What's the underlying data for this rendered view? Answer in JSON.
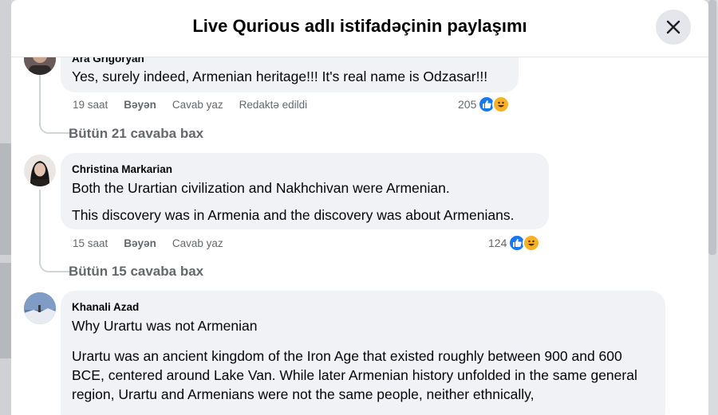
{
  "modal": {
    "title": "Live Qurious adlı istifadəçinin paylaşımı"
  },
  "comments": [
    {
      "author": "Ara Grigoryan",
      "paragraphs": [
        "Yes, surely indeed, Armenian heritage!!! It's real name is Odzasar!!!"
      ],
      "time": "19 saat",
      "like_label": "Bəyən",
      "reply_label": "Cavab yaz",
      "edited_label": "Redaktə edildi",
      "reaction_count": "205",
      "replies_label": "Bütün 21 cavaba bax"
    },
    {
      "author": "Christina Markarian",
      "paragraphs": [
        "Both the Urartian civilization and Nakhchivan were Armenian.",
        "This discovery was in Armenia and the discovery was about Armenians."
      ],
      "time": "15 saat",
      "like_label": "Bəyən",
      "reply_label": "Cavab yaz",
      "reaction_count": "124",
      "replies_label": "Bütün 15 cavaba bax"
    },
    {
      "author": "Khanali Azad",
      "paragraphs": [
        "Why Urartu was not Armenian",
        "Urartu was an ancient kingdom of the Iron Age that existed roughly between 900 and 600 BCE, centered around Lake Van. While later Armenian history unfolded in the same general region, Urartu and Armenians were not the same people, neither ethnically,"
      ]
    }
  ],
  "colors": {
    "like": "#1877f2",
    "haha": "#f7b125",
    "bubble": "#f0f2f5",
    "muted": "#65676b"
  }
}
